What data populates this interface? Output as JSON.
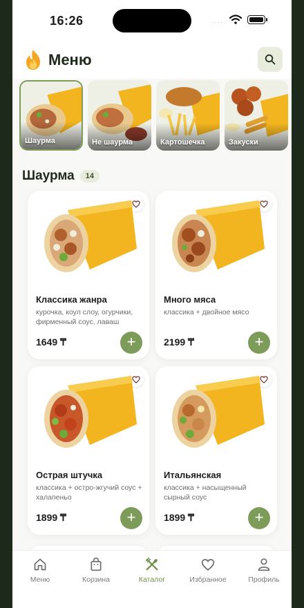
{
  "status_bar": {
    "time": "16:26",
    "signal": "····"
  },
  "header": {
    "title": "Меню"
  },
  "categories": [
    {
      "label": "Шаурма",
      "active": true
    },
    {
      "label": "Не шаурма",
      "active": false
    },
    {
      "label": "Картошечка",
      "active": false
    },
    {
      "label": "Закуски",
      "active": false
    }
  ],
  "section": {
    "title": "Шаурма",
    "count": "14"
  },
  "products": [
    {
      "name": "Классика жанра",
      "desc": "курочка, коул слоу, огурчики, фирменный соус, лаваш",
      "price": "1649 ₸"
    },
    {
      "name": "Много мяса",
      "desc": "классика + двойное мясо",
      "price": "2199 ₸"
    },
    {
      "name": "Острая штучка",
      "desc": "классика + остро-жгучий соус + халапеньо",
      "price": "1899 ₸"
    },
    {
      "name": "Итальянская",
      "desc": "классика + насыщенный сырный соус",
      "price": "1899 ₸"
    }
  ],
  "tabbar": {
    "items": [
      {
        "label": "Меню",
        "icon": "home-icon"
      },
      {
        "label": "Корзина",
        "icon": "bag-icon"
      },
      {
        "label": "Каталог",
        "icon": "utensils-icon"
      },
      {
        "label": "Избранное",
        "icon": "heart-icon"
      },
      {
        "label": "Профиль",
        "icon": "user-icon"
      }
    ],
    "active_index": 2
  },
  "colors": {
    "accent": "#7d9c5a",
    "accent_light": "#e7ecdc",
    "wrap_yellow": "#f2b51f",
    "text": "#1f2a1b"
  }
}
